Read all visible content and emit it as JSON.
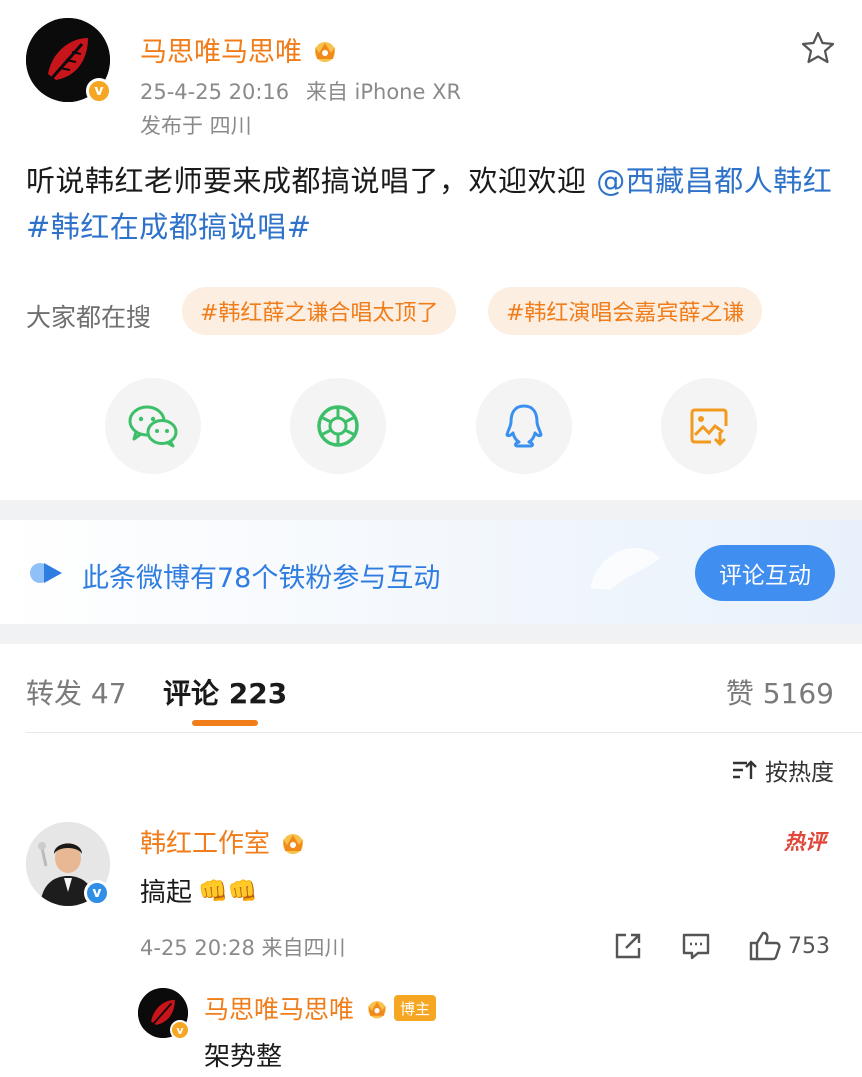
{
  "post": {
    "author": "马思唯马思唯",
    "timestamp": "25-4-25 20:16",
    "source": "来自 iPhone XR",
    "location": "发布于 四川",
    "text_plain": "听说韩红老师要来成都搞说唱了，欢迎欢迎 ",
    "mention": "@西藏昌都人韩红",
    "hashtag": "#韩红在成都搞说唱#"
  },
  "trending": {
    "label": "大家都在搜",
    "pills": [
      "#韩红薛之谦合唱太顶了",
      "#韩红演唱会嘉宾薛之谦"
    ]
  },
  "share": {
    "icons": [
      "wechat-icon",
      "moments-icon",
      "qq-icon",
      "save-image-icon"
    ]
  },
  "fans_banner": {
    "text": "此条微博有78个铁粉参与互动",
    "button": "评论互动"
  },
  "tabs": {
    "repost": "转发 47",
    "comments": "评论 223",
    "likes": "赞 5169"
  },
  "sort": {
    "label": "按热度"
  },
  "comment": {
    "author": "韩红工作室",
    "hot_badge": "热评",
    "text": "搞起",
    "emoji": "👊👊",
    "meta": "4-25 20:28 来自四川",
    "like_count": "753"
  },
  "reply": {
    "author": "马思唯马思唯",
    "badge": "博主",
    "text": "架势整"
  },
  "colors": {
    "brand_orange": "#f07d1a",
    "link_blue": "#2e72c9",
    "button_blue": "#3f8ef0",
    "hot_red": "#e0463a"
  }
}
